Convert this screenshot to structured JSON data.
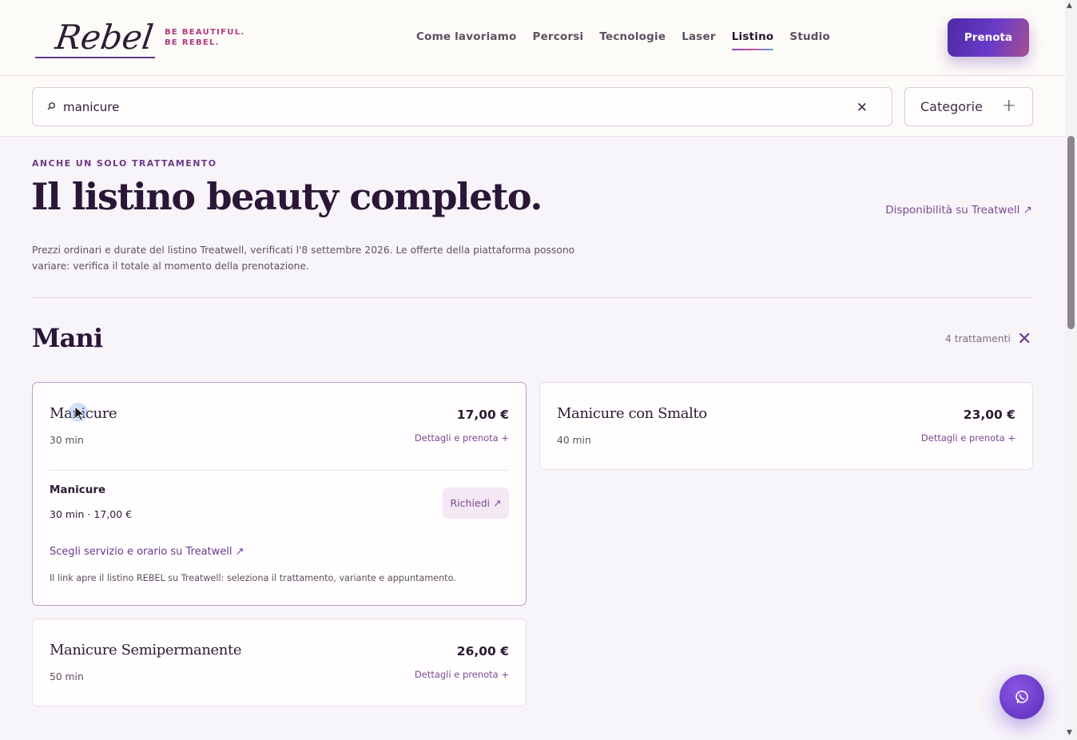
{
  "header": {
    "logo_text": "Rebel",
    "tagline": "BE BEAUTIFUL. BE REBEL.",
    "nav": [
      {
        "label": "Come lavoriamo",
        "active": false
      },
      {
        "label": "Percorsi",
        "active": false
      },
      {
        "label": "Tecnologie",
        "active": false
      },
      {
        "label": "Laser",
        "active": false
      },
      {
        "label": "Listino",
        "active": true
      },
      {
        "label": "Studio",
        "active": false
      }
    ],
    "cta_label": "Prenota"
  },
  "search": {
    "value": "manicure",
    "icon": "search-icon",
    "clear_icon": "close-icon",
    "categories_label": "Categorie",
    "categories_icon": "plus-icon"
  },
  "intro": {
    "eyebrow": "ANCHE UN SOLO TRATTAMENTO",
    "title": "Il listino beauty completo.",
    "availability_link": "Disponibilità su Treatwell ↗",
    "text": "Prezzi ordinari e durate del listino Treatwell, verificati l'8 settembre 2026. Le offerte della piattaforma possono variare: verifica il totale al momento della prenotazione."
  },
  "section": {
    "title": "Mani",
    "count": "4 trattamenti",
    "close_icon": "close-icon",
    "cards": [
      {
        "name": "Manicure",
        "duration": "30 min",
        "price": "17,00 €",
        "details_label": "Dettagli e prenota +",
        "expanded": true,
        "variant_name": "Manicure",
        "variant_meta": "30 min · 17,00 €",
        "request_label": "Richiedi ↗",
        "treatwell_link": "Scegli servizio e orario su Treatwell ↗",
        "note": "Il link apre il listino REBEL su Treatwell: seleziona il trattamento, variante e appuntamento."
      },
      {
        "name": "Manicure con Smalto",
        "duration": "40 min",
        "price": "23,00 €",
        "details_label": "Dettagli e prenota +",
        "expanded": false
      },
      {
        "name": "Manicure Semipermanente",
        "duration": "50 min",
        "price": "26,00 €",
        "details_label": "Dettagli e prenota +",
        "expanded": false
      }
    ]
  },
  "floating": {
    "whatsapp_icon": "whatsapp-icon"
  },
  "colors": {
    "brand": "#5a2db7",
    "accent": "#b23a7c",
    "link": "#7b4a94"
  }
}
